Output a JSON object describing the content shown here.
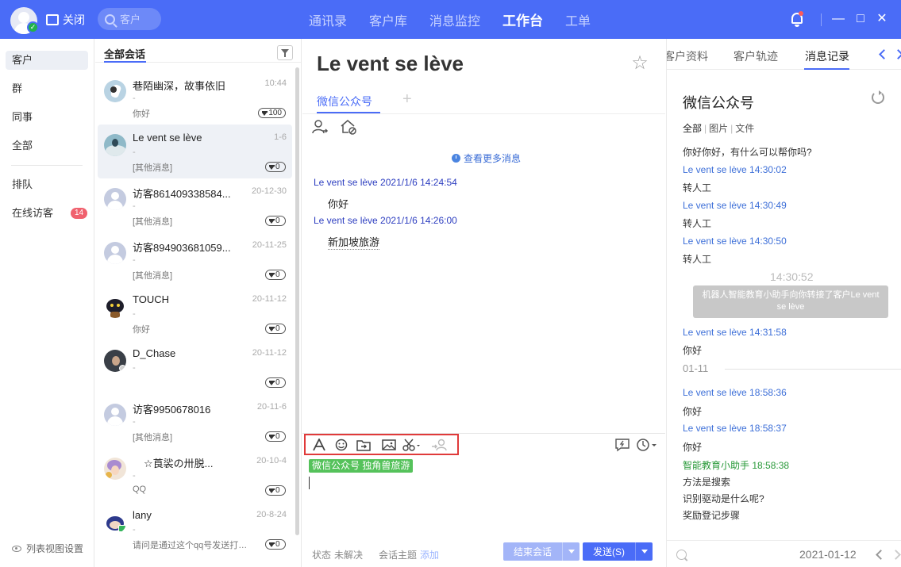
{
  "topbar": {
    "close_label": "关闭",
    "search_placeholder": "客户",
    "nav": [
      "通讯录",
      "客户库",
      "消息监控",
      "工作台",
      "工单"
    ],
    "active_nav": "工作台",
    "window": {
      "minimize": "—",
      "maximize": "□",
      "close": "✕"
    }
  },
  "leftnav": {
    "items": [
      "客户",
      "群",
      "同事",
      "全部",
      "排队",
      "在线访客"
    ],
    "visitor_count": "14",
    "list_settings": "列表视图设置"
  },
  "convlist": {
    "title": "全部会话",
    "items": [
      {
        "name": "巷陌幽深，故事依旧",
        "time": "10:44",
        "dash": "-",
        "sub": "你好",
        "gems": "100"
      },
      {
        "name": "Le vent se lève",
        "time": "1-6",
        "dash": "-",
        "sub": "[其他消息]",
        "gems": "0"
      },
      {
        "name": "访客861409338584...",
        "time": "20-12-30",
        "dash": "-",
        "sub": "[其他消息]",
        "gems": "0"
      },
      {
        "name": "访客894903681059...",
        "time": "20-11-25",
        "dash": "-",
        "sub": "[其他消息]",
        "gems": "0"
      },
      {
        "name": "TOUCH",
        "time": "20-11-12",
        "dash": "-",
        "sub": "你好",
        "gems": "0"
      },
      {
        "name": "D_Chase",
        "time": "20-11-12",
        "dash": "-",
        "sub": "",
        "gems": "0"
      },
      {
        "name": "访客9950678016",
        "time": "20-11-6",
        "dash": "-",
        "sub": "[其他消息]",
        "gems": "0"
      },
      {
        "name": "☆莨裟の卅脱...",
        "time": "20-10-4",
        "dash": "-",
        "sub": "QQ",
        "gems": "0"
      },
      {
        "name": "lany",
        "time": "20-8-24",
        "dash": "-",
        "sub": "请问是通过这个qq号发送打印...",
        "gems": "0"
      }
    ]
  },
  "chat": {
    "title": "Le vent se lève",
    "channel_tab": "微信公众号",
    "more_messages": "查看更多消息",
    "messages": [
      {
        "meta": "Le vent se lève 2021/1/6 14:24:54",
        "text": "你好"
      },
      {
        "meta": "Le vent se lève 2021/1/6 14:26:00",
        "text": "新加坡旅游"
      }
    ],
    "channel_badge": "微信公众号 独角兽旅游",
    "status_label": "状态",
    "status_value": "未解决",
    "topic_label": "会话主题",
    "topic_add": "添加",
    "end_button": "结束会话",
    "send_button": "发送(S)"
  },
  "rpanel": {
    "tabs": [
      "客户资料",
      "客户轨迹",
      "消息记录"
    ],
    "active_tab": "消息记录",
    "title": "微信公众号",
    "filters": [
      "全部",
      "图片",
      "文件"
    ],
    "greeting": "你好你好，有什么可以帮你吗?",
    "log": [
      {
        "meta": "Le vent se lève 14:30:02",
        "text": "转人工"
      },
      {
        "meta": "Le vent se lève 14:30:49",
        "text": "转人工"
      },
      {
        "meta": "Le vent se lève 14:30:50",
        "text": "转人工"
      }
    ],
    "center_time": "14:30:52",
    "system_msg": "机器人智能教育小助手向你转接了客户Le vent se lève",
    "log2": {
      "meta": "Le vent se lève 14:31:58",
      "text": "你好"
    },
    "date_sep": "01-11",
    "log3": [
      {
        "meta": "Le vent se lève 18:58:36",
        "text": "你好"
      },
      {
        "meta": "Le vent se lève 18:58:37",
        "text": "你好"
      }
    ],
    "assistant": {
      "meta": "智能教育小助手 18:58:38",
      "lines": [
        "方法是搜索",
        "识别驱动是什么呢?",
        "奖励登记步骤"
      ]
    },
    "footer_date": "2021-01-12"
  }
}
